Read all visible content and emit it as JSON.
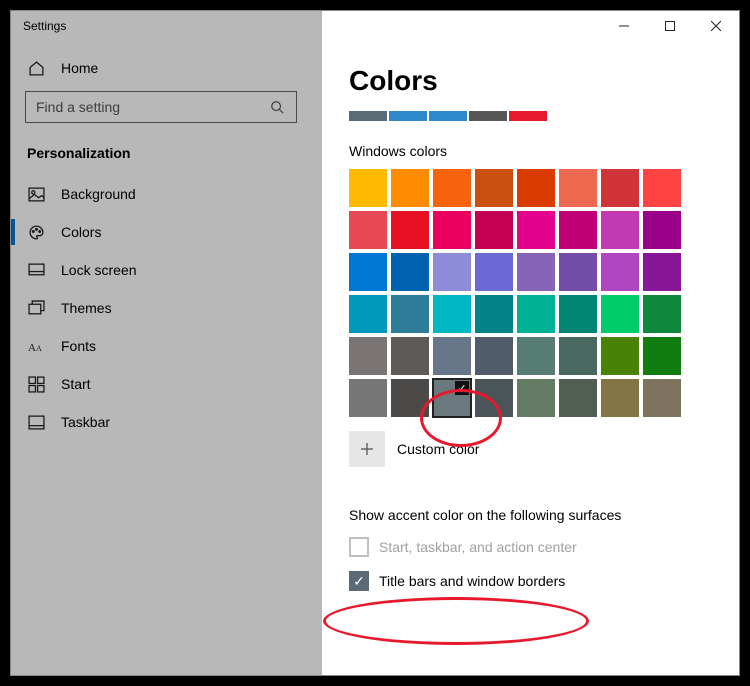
{
  "window": {
    "title": "Settings"
  },
  "sidebar": {
    "home": "Home",
    "search_placeholder": "Find a setting",
    "category": "Personalization",
    "items": [
      {
        "label": "Background"
      },
      {
        "label": "Colors",
        "active": true
      },
      {
        "label": "Lock screen"
      },
      {
        "label": "Themes"
      },
      {
        "label": "Fonts"
      },
      {
        "label": "Start"
      },
      {
        "label": "Taskbar"
      }
    ]
  },
  "page": {
    "title": "Colors",
    "recent_colors": [
      "#5b6b75",
      "#2d89c9",
      "#2d89c9",
      "#565656",
      "#e8192c"
    ],
    "windows_colors_label": "Windows colors",
    "palette": [
      "#ffb900",
      "#ff8c00",
      "#f7630c",
      "#ca5010",
      "#da3b01",
      "#ef6950",
      "#d13438",
      "#ff4343",
      "#e74856",
      "#e81123",
      "#ea005e",
      "#c30052",
      "#e3008c",
      "#bf0077",
      "#c239b3",
      "#9a0089",
      "#0078d4",
      "#0063b1",
      "#8e8cd8",
      "#6b69d6",
      "#8764b8",
      "#744da9",
      "#b146c2",
      "#881798",
      "#0099bc",
      "#2d7d9a",
      "#00b7c3",
      "#038387",
      "#00b294",
      "#018574",
      "#00cc6a",
      "#10893e",
      "#7a7574",
      "#5d5a58",
      "#68768a",
      "#515c6b",
      "#567c73",
      "#486860",
      "#498205",
      "#107c10",
      "#767676",
      "#4c4a48",
      "#69797e",
      "#4a5459",
      "#647c64",
      "#525e54",
      "#847545",
      "#7e735f"
    ],
    "selected_index": 42,
    "custom_label": "Custom color",
    "accent_section": "Show accent color on the following surfaces",
    "accent_opts": [
      {
        "label": "Start, taskbar, and action center",
        "checked": false,
        "disabled": true
      },
      {
        "label": "Title bars and window borders",
        "checked": true,
        "disabled": false
      }
    ]
  }
}
